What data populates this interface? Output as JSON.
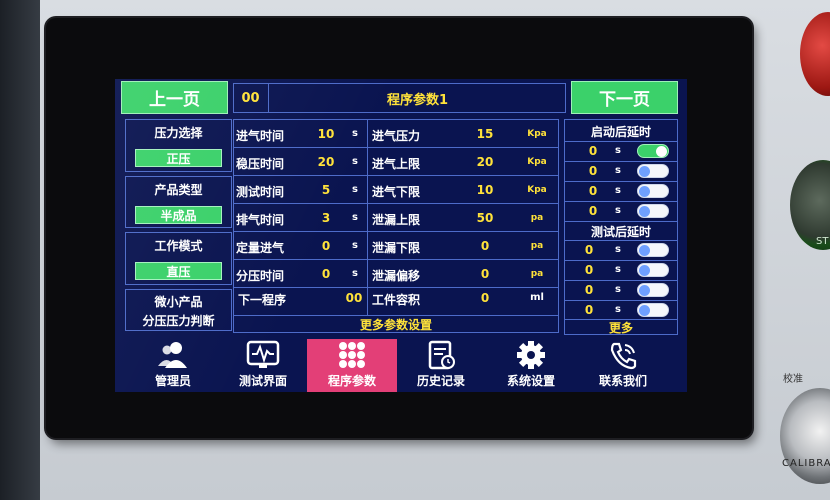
{
  "nav": {
    "prev_label": "上一页",
    "next_label": "下一页"
  },
  "header": {
    "program_number": "00",
    "title": "程序参数1"
  },
  "left_panel": {
    "pressure_select": {
      "title": "压力选择",
      "value": "正压"
    },
    "product_type": {
      "title": "产品类型",
      "value": "半成品"
    },
    "work_mode": {
      "title": "工作模式",
      "value": "直压"
    },
    "micro_product": {
      "line1": "微小产品",
      "line2": "分压压力判断"
    }
  },
  "params_left": [
    {
      "label": "进气时间",
      "value": "10",
      "unit": "s"
    },
    {
      "label": "稳压时间",
      "value": "20",
      "unit": "s"
    },
    {
      "label": "测试时间",
      "value": "5",
      "unit": "s"
    },
    {
      "label": "排气时间",
      "value": "3",
      "unit": "s"
    },
    {
      "label": "定量进气",
      "value": "0",
      "unit": "s"
    },
    {
      "label": "分压时间",
      "value": "0",
      "unit": "s"
    },
    {
      "label": "下一程序",
      "value": "00",
      "unit": ""
    }
  ],
  "params_right": [
    {
      "label": "进气压力",
      "value": "15",
      "unit": "Kpa"
    },
    {
      "label": "进气上限",
      "value": "20",
      "unit": "Kpa"
    },
    {
      "label": "进气下限",
      "value": "10",
      "unit": "Kpa"
    },
    {
      "label": "泄漏上限",
      "value": "50",
      "unit": "pa"
    },
    {
      "label": "泄漏下限",
      "value": "0",
      "unit": "pa"
    },
    {
      "label": "泄漏偏移",
      "value": "0",
      "unit": "pa"
    },
    {
      "label": "工件容积",
      "value": "0",
      "unit": "ml"
    }
  ],
  "more_params_label": "更多参数设置",
  "right_panel": {
    "start_delay_title": "启动后延时",
    "start_delays": [
      {
        "value": "0",
        "unit": "s",
        "on": true
      },
      {
        "value": "0",
        "unit": "s",
        "on": false
      },
      {
        "value": "0",
        "unit": "s",
        "on": false
      },
      {
        "value": "0",
        "unit": "s",
        "on": false
      }
    ],
    "test_delay_title": "测试后延时",
    "test_delays": [
      {
        "value": "0",
        "unit": "s",
        "on": false
      },
      {
        "value": "0",
        "unit": "s",
        "on": false
      },
      {
        "value": "0",
        "unit": "s",
        "on": false
      },
      {
        "value": "0",
        "unit": "s",
        "on": false
      }
    ],
    "more_label": "更多"
  },
  "tabs": [
    {
      "label": "管理员",
      "icon": "admin-icon",
      "active": false
    },
    {
      "label": "测试界面",
      "icon": "monitor-icon",
      "active": false
    },
    {
      "label": "程序参数",
      "icon": "grid-icon",
      "active": true
    },
    {
      "label": "历史记录",
      "icon": "history-icon",
      "active": false
    },
    {
      "label": "系统设置",
      "icon": "gear-icon",
      "active": false
    },
    {
      "label": "联系我们",
      "icon": "phone-icon",
      "active": false
    }
  ],
  "device": {
    "side_label": "校准",
    "calibration_label": "CALIBRA",
    "green_button_label": "ST"
  },
  "colors": {
    "screen_bg": "#0a1450",
    "accent_green": "#3bd16a",
    "value_yellow": "#ffe23a",
    "active_tab": "#e33f77",
    "grid_line": "#4d6bc9"
  }
}
